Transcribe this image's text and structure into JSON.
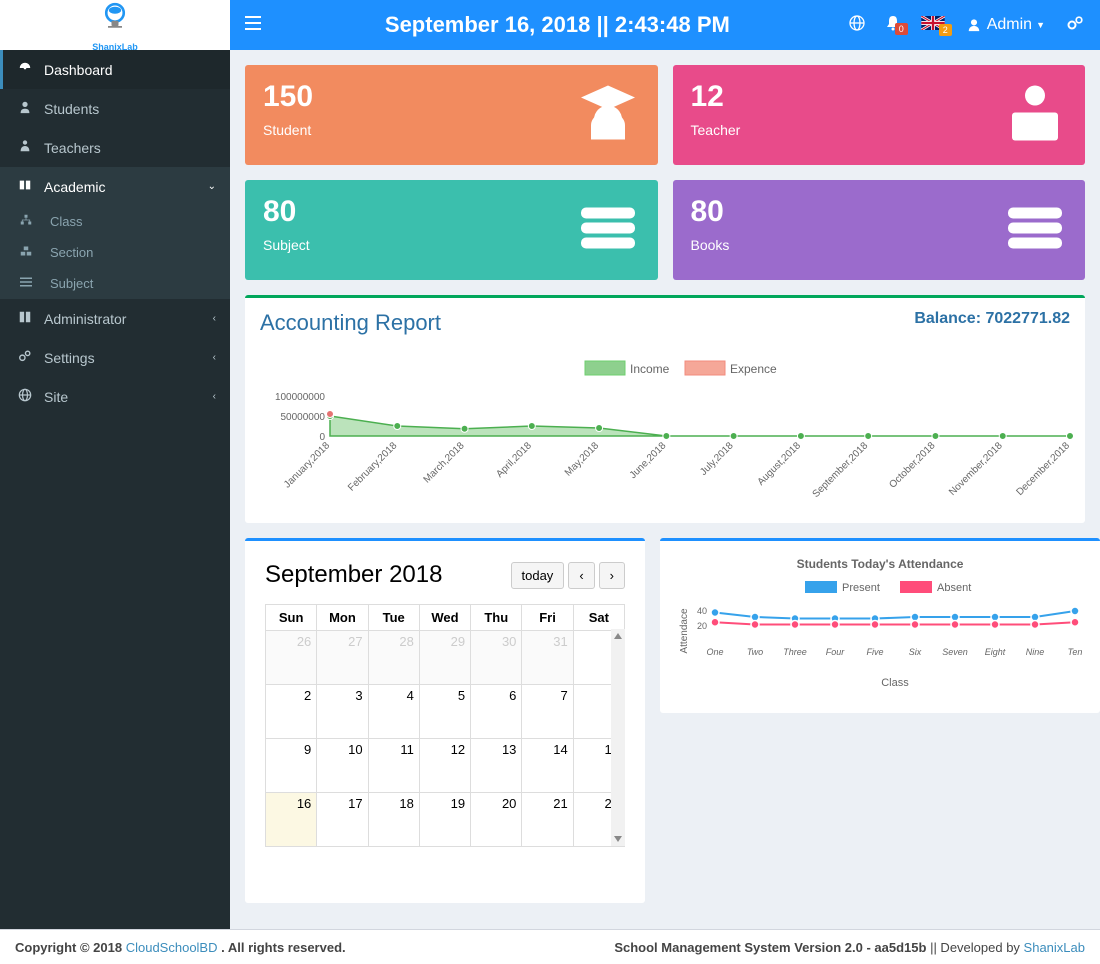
{
  "header": {
    "date_title": "September 16, 2018 || 2:43:48 PM",
    "notif_badge": "0",
    "flag_badge": "2",
    "user_label": "Admin"
  },
  "sidebar": {
    "items": [
      {
        "label": "Dashboard"
      },
      {
        "label": "Students"
      },
      {
        "label": "Teachers"
      },
      {
        "label": "Academic"
      },
      {
        "label": "Administrator"
      },
      {
        "label": "Settings"
      },
      {
        "label": "Site"
      }
    ],
    "sub": [
      {
        "label": "Class"
      },
      {
        "label": "Section"
      },
      {
        "label": "Subject"
      }
    ]
  },
  "cards": {
    "student": {
      "num": "150",
      "label": "Student"
    },
    "teacher": {
      "num": "12",
      "label": "Teacher"
    },
    "subject": {
      "num": "80",
      "label": "Subject"
    },
    "books": {
      "num": "80",
      "label": "Books"
    }
  },
  "accounting": {
    "title": "Accounting Report",
    "balance_label": "Balance: 7022771.82",
    "legend": {
      "income": "Income",
      "expence": "Expence"
    },
    "yticks": [
      "100000000",
      "50000000",
      "0"
    ]
  },
  "calendar": {
    "title": "September 2018",
    "today_btn": "today",
    "days": [
      "Sun",
      "Mon",
      "Tue",
      "Wed",
      "Thu",
      "Fri",
      "Sat"
    ]
  },
  "attendance": {
    "title": "Students Today's Attendance",
    "legend": {
      "present": "Present",
      "absent": "Absent"
    },
    "ylabel": "Attendace",
    "xlabel": "Class",
    "yticks": [
      "40",
      "20"
    ]
  },
  "footer": {
    "copyright_prefix": "Copyright © 2018 ",
    "brand": "CloudSchoolBD ",
    "rights": ". All rights reserved.",
    "version_label": "School Management System Version 2.0 - aa5d15b ",
    "dev_prefix": "|| Developed by ",
    "dev_name": "ShanixLab"
  },
  "chart_data": [
    {
      "id": "accounting_report",
      "type": "area",
      "x": [
        "January,2018",
        "February,2018",
        "March,2018",
        "April,2018",
        "May,2018",
        "June,2018",
        "July,2018",
        "August,2018",
        "September,2018",
        "October,2018",
        "November,2018",
        "December,2018"
      ],
      "series": [
        {
          "name": "Income",
          "color": "#6fcf6f",
          "values": [
            50000000,
            25000000,
            18000000,
            25000000,
            20000000,
            0,
            0,
            0,
            0,
            0,
            0,
            0
          ]
        },
        {
          "name": "Expence",
          "color": "#f28b7d",
          "values": [
            55000000,
            0,
            0,
            0,
            0,
            0,
            0,
            0,
            0,
            0,
            0,
            0
          ]
        }
      ],
      "ylim": [
        0,
        100000000
      ],
      "legend_position": "top"
    },
    {
      "id": "attendance_chart",
      "type": "line",
      "title": "Students Today's Attendance",
      "x": [
        "One",
        "Two",
        "Three",
        "Four",
        "Five",
        "Six",
        "Seven",
        "Eight",
        "Nine",
        "Ten"
      ],
      "series": [
        {
          "name": "Present",
          "color": "#36a2eb",
          "values": [
            38,
            32,
            30,
            30,
            30,
            32,
            32,
            32,
            32,
            40
          ]
        },
        {
          "name": "Absent",
          "color": "#ff4d7a",
          "values": [
            25,
            22,
            22,
            22,
            22,
            22,
            22,
            22,
            22,
            25
          ]
        }
      ],
      "xlabel": "Class",
      "ylabel": "Attendace",
      "ylim": [
        0,
        40
      ]
    }
  ]
}
